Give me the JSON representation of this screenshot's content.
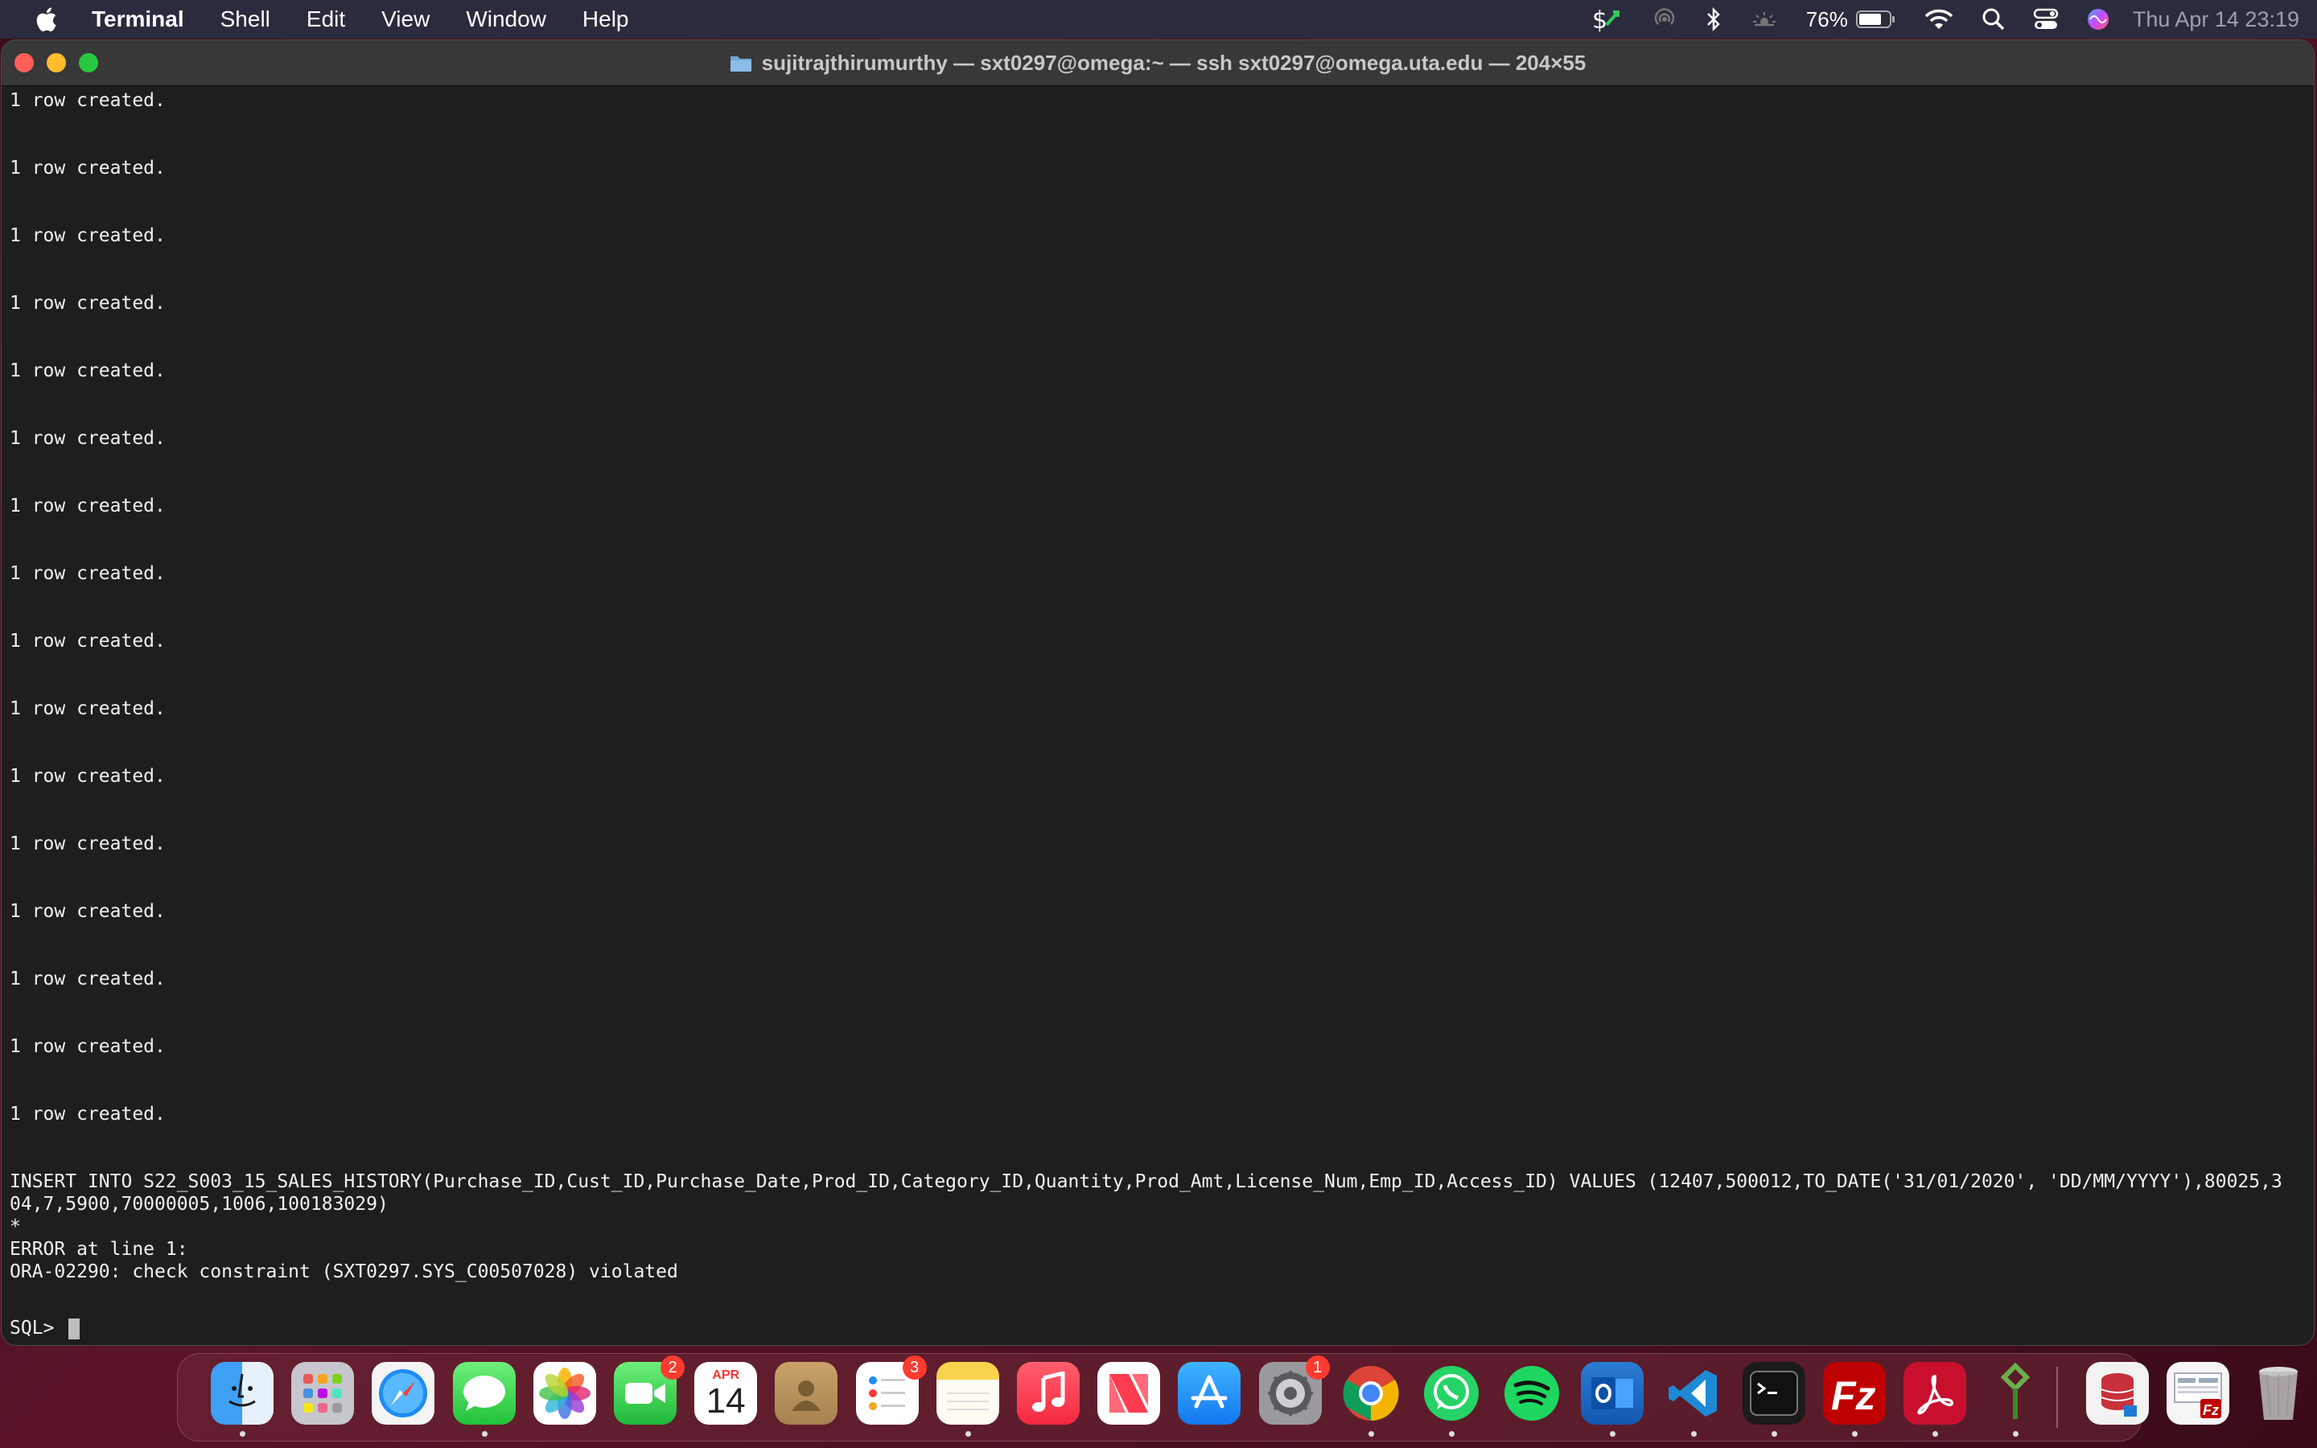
{
  "menubar": {
    "app_name": "Terminal",
    "items": [
      "Shell",
      "Edit",
      "View",
      "Window",
      "Help"
    ],
    "battery_percent": "76%",
    "datetime": "Thu Apr 14  23:19",
    "status_icons": [
      "money-sync-icon",
      "airdrop-icon",
      "bluetooth-icon",
      "display-brightness-icon",
      "battery-icon",
      "wifi-icon",
      "spotlight-search-icon",
      "control-center-icon",
      "siri-icon"
    ]
  },
  "window": {
    "title": "sujitrajthirumurthy — sxt0297@omega:~ — ssh sxt0297@omega.uta.edu — 204×55"
  },
  "terminal": {
    "created_message": "1 row created.",
    "created_count": 16,
    "insert_statement_1": "INSERT INTO S22_S003_15_SALES_HISTORY(Purchase_ID,Cust_ID,Purchase_Date,Prod_ID,Category_ID,Quantity,Prod_Amt,License_Num,Emp_ID,Access_ID) VALUES (12407,500012,TO_DATE('31/01/2020', 'DD/MM/YYYY'),80025,3",
    "insert_statement_2": "04,7,5900,70000005,1006,100183029)",
    "error_marker": "*",
    "error_location": "ERROR at line 1:",
    "error_message": "ORA-02290: check constraint (SXT0297.SYS_C00507028) violated",
    "prompt": "SQL> "
  },
  "dock": {
    "apps": [
      {
        "name": "Finder",
        "icon": "finder-icon",
        "running": true
      },
      {
        "name": "Launchpad",
        "icon": "launchpad-icon",
        "running": false
      },
      {
        "name": "Safari",
        "icon": "safari-icon",
        "running": false
      },
      {
        "name": "Messages",
        "icon": "messages-icon",
        "running": true
      },
      {
        "name": "Photos",
        "icon": "photos-icon",
        "running": false
      },
      {
        "name": "FaceTime",
        "icon": "facetime-icon",
        "running": false,
        "badge": "2"
      },
      {
        "name": "Calendar",
        "icon": "calendar-icon",
        "running": false,
        "month": "APR",
        "day": "14"
      },
      {
        "name": "Contacts",
        "icon": "contacts-icon",
        "running": false
      },
      {
        "name": "Reminders",
        "icon": "reminders-icon",
        "running": false,
        "badge": "3"
      },
      {
        "name": "Notes",
        "icon": "notes-icon",
        "running": true
      },
      {
        "name": "Music",
        "icon": "music-icon",
        "running": false
      },
      {
        "name": "News",
        "icon": "news-icon",
        "running": false
      },
      {
        "name": "App Store",
        "icon": "app-store-icon",
        "running": false
      },
      {
        "name": "System Preferences",
        "icon": "system-preferences-icon",
        "running": false,
        "badge": "1"
      },
      {
        "name": "Chrome",
        "icon": "chrome-icon",
        "running": true
      },
      {
        "name": "WhatsApp",
        "icon": "whatsapp-icon",
        "running": true
      },
      {
        "name": "Spotify",
        "icon": "spotify-icon",
        "running": false
      },
      {
        "name": "Outlook",
        "icon": "outlook-icon",
        "running": true
      },
      {
        "name": "VS Code",
        "icon": "vscode-icon",
        "running": true
      },
      {
        "name": "Terminal",
        "icon": "terminal-icon",
        "running": true
      },
      {
        "name": "FileZilla",
        "icon": "filezilla-icon",
        "running": true
      },
      {
        "name": "Acrobat",
        "icon": "acrobat-icon",
        "running": true
      },
      {
        "name": "Sourcetree",
        "icon": "sourcetree-icon",
        "running": true
      },
      {
        "name": "Database File",
        "icon": "database-file-icon",
        "running": false
      },
      {
        "name": "FileZilla Window",
        "icon": "filezilla-window-icon",
        "running": false
      },
      {
        "name": "Trash",
        "icon": "trash-icon",
        "running": false
      }
    ]
  }
}
